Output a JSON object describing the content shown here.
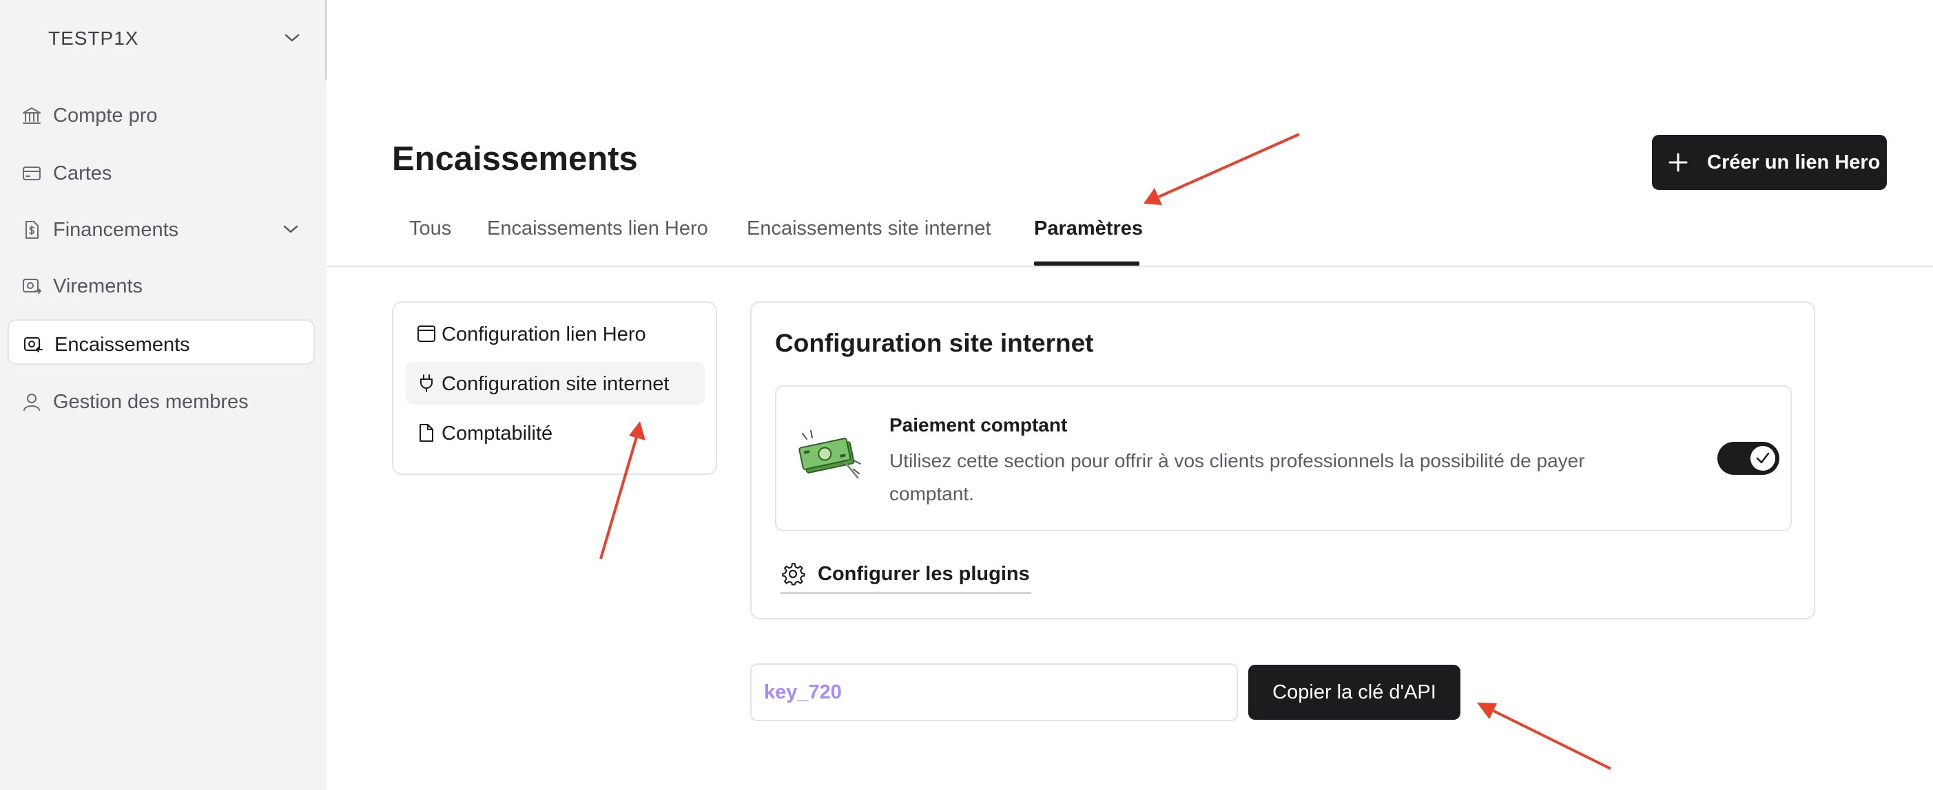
{
  "sidebar": {
    "org_name": "TESTP1X",
    "items": [
      {
        "label": "Compte pro",
        "icon": "bank-icon"
      },
      {
        "label": "Cartes",
        "icon": "card-icon"
      },
      {
        "label": "Financements",
        "icon": "document-dollar-icon"
      },
      {
        "label": "Virements",
        "icon": "transfer-icon"
      },
      {
        "label": "Encaissements",
        "icon": "cash-register-icon",
        "active": true
      },
      {
        "label": "Gestion des membres",
        "icon": "user-icon"
      }
    ]
  },
  "header": {
    "title": "Encaissements",
    "create_button_label": "Créer un lien Hero"
  },
  "tabs": [
    {
      "label": "Tous"
    },
    {
      "label": "Encaissements lien Hero"
    },
    {
      "label": "Encaissements site internet"
    },
    {
      "label": "Paramètres",
      "active": true
    }
  ],
  "settings_menu": [
    {
      "label": "Configuration lien Hero",
      "icon": "browser-icon"
    },
    {
      "label": "Configuration site internet",
      "icon": "plug-icon",
      "active": true
    },
    {
      "label": "Comptabilité",
      "icon": "file-icon"
    }
  ],
  "config": {
    "title": "Configuration site internet",
    "payment_title": "Paiement comptant",
    "payment_description": "Utilisez cette section pour offrir à vos clients professionnels la possibilité de payer comptant.",
    "toggle_on": true,
    "plugins_label": "Configurer les plugins"
  },
  "api": {
    "key_value": "key_720",
    "copy_label": "Copier la clé d'API"
  },
  "colors": {
    "primary": "#1c1c1e",
    "sidebar_bg": "#f3f3f4",
    "api_key_text": "#a78bfa",
    "annotation_arrow": "#e5432d"
  }
}
